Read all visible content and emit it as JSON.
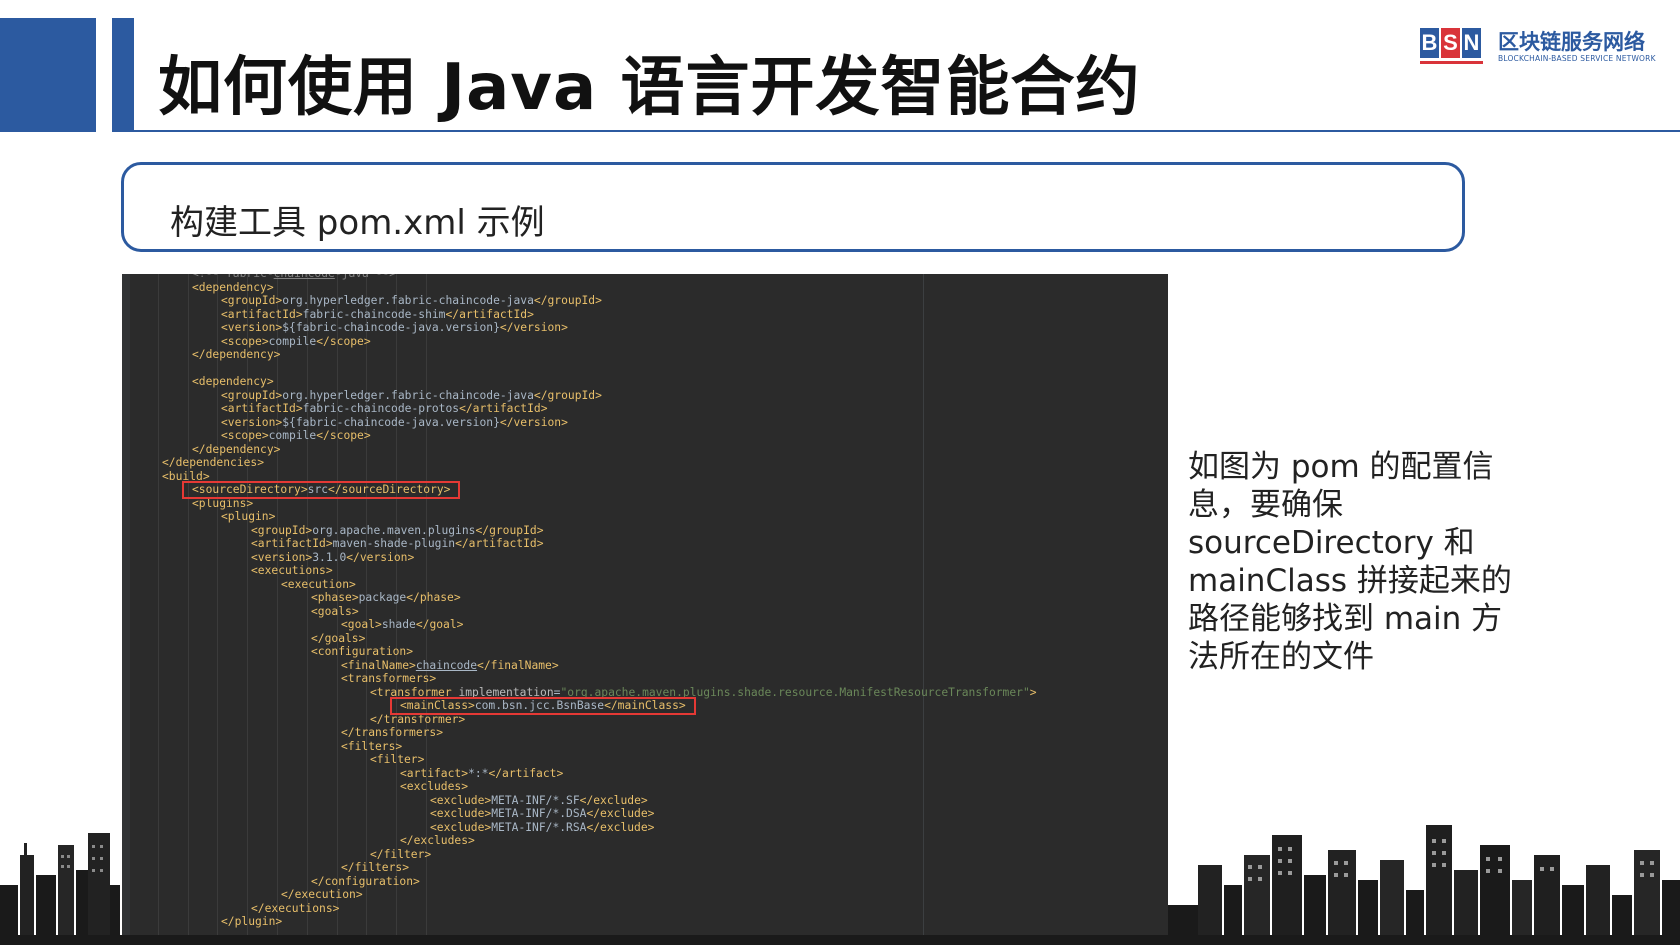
{
  "header": {
    "title": "如何使用 Java 语言开发智能合约"
  },
  "logo": {
    "letters": [
      "B",
      "S",
      "N"
    ],
    "name_cn": "区块链服务网络",
    "name_en": "BLOCKCHAIN-BASED SERVICE NETWORK"
  },
  "subtitle": "构建工具 pom.xml 示例",
  "note": "如图为 pom 的配置信\n息，要确保\nsourceDirectory 和\nmainClass 拼接起来的\n路径能够找到 main 方\n法所在的文件",
  "code_lines": [
    "<!-- fabric-chaincode-java -->",
    "<dependency>",
    "<groupId>org.hyperledger.fabric-chaincode-java</groupId>",
    "<artifactId>fabric-chaincode-shim</artifactId>",
    "<version>${fabric-chaincode-java.version}</version>",
    "<scope>compile</scope>",
    "</dependency>",
    "",
    "<dependency>",
    "<groupId>org.hyperledger.fabric-chaincode-java</groupId>",
    "<artifactId>fabric-chaincode-protos</artifactId>",
    "<version>${fabric-chaincode-java.version}</version>",
    "<scope>compile</scope>",
    "</dependency>",
    "</dependencies>",
    "<build>",
    "<sourceDirectory>src</sourceDirectory>",
    "<plugins>",
    "<plugin>",
    "<groupId>org.apache.maven.plugins</groupId>",
    "<artifactId>maven-shade-plugin</artifactId>",
    "<version>3.1.0</version>",
    "<executions>",
    "<execution>",
    "<phase>package</phase>",
    "<goals>",
    "<goal>shade</goal>",
    "</goals>",
    "<configuration>",
    "<finalName>chaincode</finalName>",
    "<transformers>",
    "<transformer implementation=\"org.apache.maven.plugins.shade.resource.ManifestResourceTransformer\">",
    "<mainClass>com.bsn.jcc.BsnBase</mainClass>",
    "</transformer>",
    "</transformers>",
    "<filters>",
    "<filter>",
    "<artifact>*:*</artifact>",
    "<excludes>",
    "<exclude>META-INF/*.SF</exclude>",
    "<exclude>META-INF/*.DSA</exclude>",
    "<exclude>META-INF/*.RSA</exclude>",
    "</excludes>",
    "</filter>",
    "</filters>",
    "</configuration>",
    "</execution>",
    "</executions>",
    "</plugin>"
  ]
}
